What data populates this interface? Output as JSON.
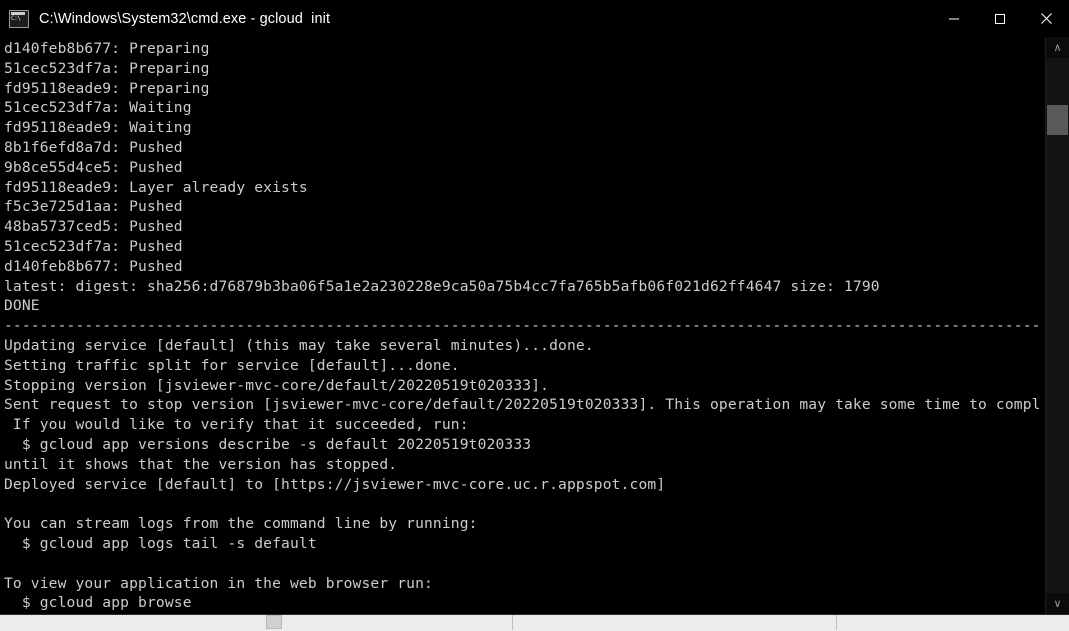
{
  "window": {
    "title": "C:\\Windows\\System32\\cmd.exe - gcloud  init",
    "icon": "cmd-console-icon",
    "background_color": "#000000",
    "text_color": "#cccccc",
    "controls": {
      "minimize_label": "–",
      "maximize_label": "□",
      "close_label": "✕"
    }
  },
  "scrollbar": {
    "up_arrow": "∧",
    "down_arrow": "∨",
    "thumb_color": "#5a5a5a"
  },
  "console": {
    "lines": [
      "d140feb8b677: Preparing",
      "51cec523df7a: Preparing",
      "fd95118eade9: Preparing",
      "51cec523df7a: Waiting",
      "fd95118eade9: Waiting",
      "8b1f6efd8a7d: Pushed",
      "9b8ce55d4ce5: Pushed",
      "fd95118eade9: Layer already exists",
      "f5c3e725d1aa: Pushed",
      "48ba5737ced5: Pushed",
      "51cec523df7a: Pushed",
      "d140feb8b677: Pushed",
      "latest: digest: sha256:d76879b3ba06f5a1e2a230228e9ca50a75b4cc7fa765b5afb06f021d62ff4647 size: 1790",
      "DONE",
      "--------------------------------------------------------------------------------------------------------------------------------",
      "Updating service [default] (this may take several minutes)...done.",
      "Setting traffic split for service [default]...done.",
      "Stopping version [jsviewer-mvc-core/default/20220519t020333].",
      "Sent request to stop version [jsviewer-mvc-core/default/20220519t020333]. This operation may take some time to complete.",
      " If you would like to verify that it succeeded, run:",
      "  $ gcloud app versions describe -s default 20220519t020333",
      "until it shows that the version has stopped.",
      "Deployed service [default] to [https://jsviewer-mvc-core.uc.r.appspot.com]",
      "",
      "You can stream logs from the command line by running:",
      "  $ gcloud app logs tail -s default",
      "",
      "To view your application in the web browser run:",
      "  $ gcloud app browse"
    ]
  }
}
